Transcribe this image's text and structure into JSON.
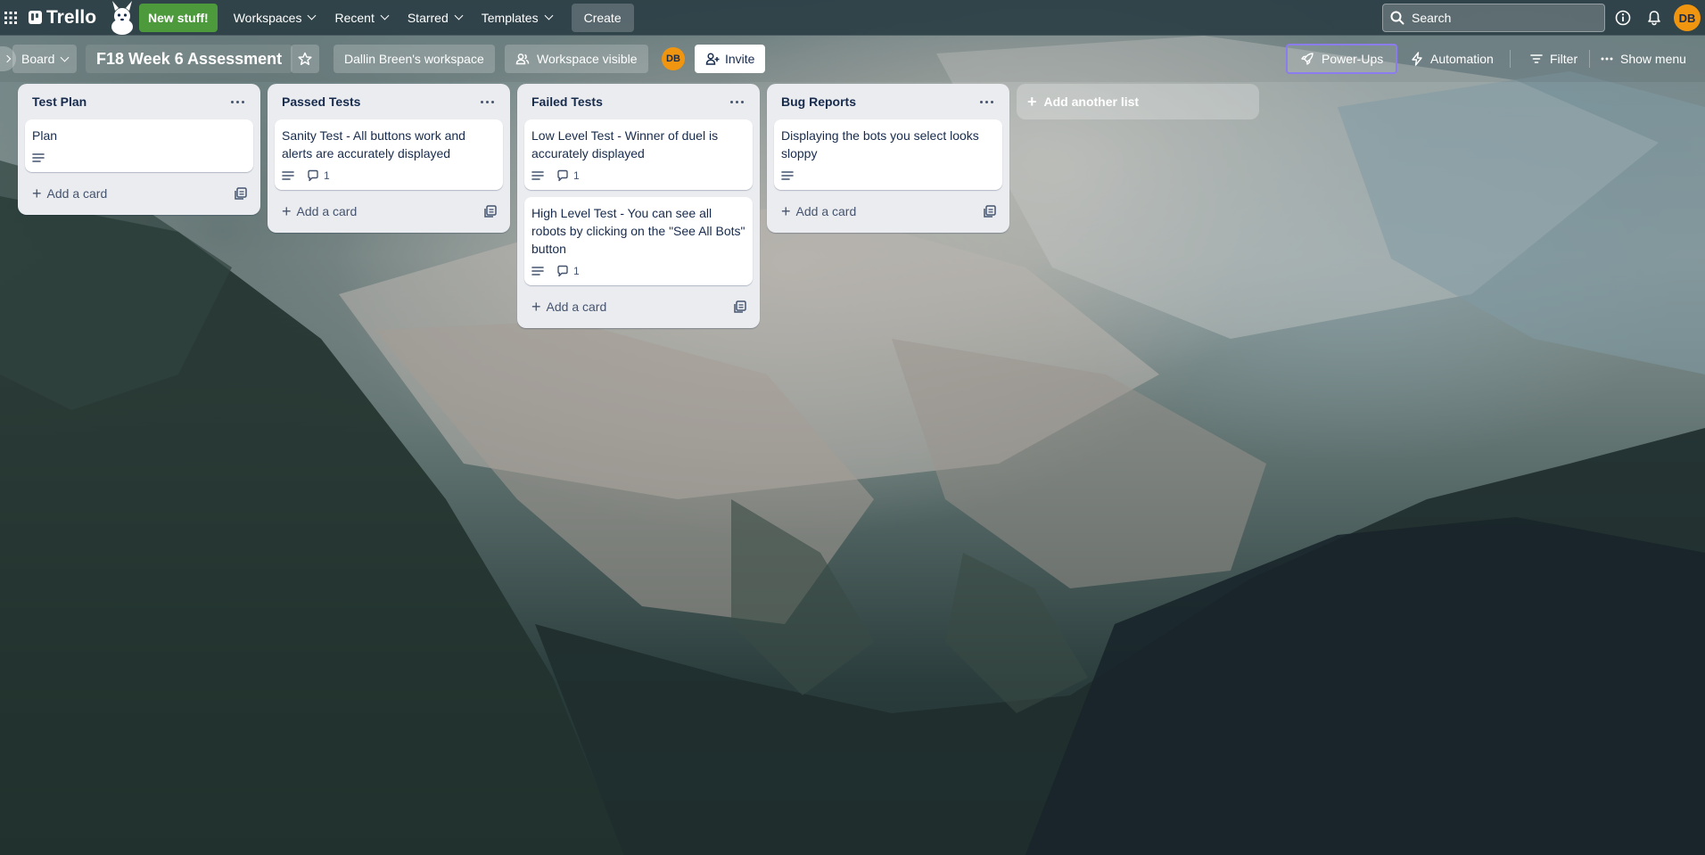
{
  "nav": {
    "brand": "Trello",
    "new_stuff": "New stuff!",
    "menu": [
      {
        "label": "Workspaces"
      },
      {
        "label": "Recent"
      },
      {
        "label": "Starred"
      },
      {
        "label": "Templates"
      }
    ],
    "create": "Create",
    "search_placeholder": "Search",
    "avatar_initials": "DB"
  },
  "board": {
    "view": "Board",
    "title": "F18 Week 6 Assessment",
    "workspace": "Dallin Breen's workspace",
    "visibility": "Workspace visible",
    "member_initials": "DB",
    "invite": "Invite",
    "powerups": "Power-Ups",
    "automation": "Automation",
    "filter": "Filter",
    "show_menu": "Show menu"
  },
  "lists": [
    {
      "title": "Test Plan",
      "cards": [
        {
          "title": "Plan",
          "has_description": true,
          "comments": ""
        }
      ],
      "add_card": "Add a card"
    },
    {
      "title": "Passed Tests",
      "cards": [
        {
          "title": "Sanity Test - All buttons work and alerts are accurately displayed",
          "has_description": true,
          "comments": "1"
        }
      ],
      "add_card": "Add a card"
    },
    {
      "title": "Failed Tests",
      "cards": [
        {
          "title": "Low Level Test - Winner of duel is accurately displayed",
          "has_description": true,
          "comments": "1"
        },
        {
          "title": "High Level Test - You can see all robots by clicking on the \"See All Bots\" button",
          "has_description": true,
          "comments": "1"
        }
      ],
      "add_card": "Add a card"
    },
    {
      "title": "Bug Reports",
      "cards": [
        {
          "title": "Displaying the bots you select looks sloppy",
          "has_description": true,
          "comments": ""
        }
      ],
      "add_card": "Add a card"
    }
  ],
  "add_list": "Add another list",
  "colors": {
    "nav_bg": "#2a3e44",
    "new_stuff": "#4c9a3c",
    "avatar": "#f0950f",
    "list_bg": "#ebecf0",
    "powerups_border": "#8b7cf0"
  }
}
